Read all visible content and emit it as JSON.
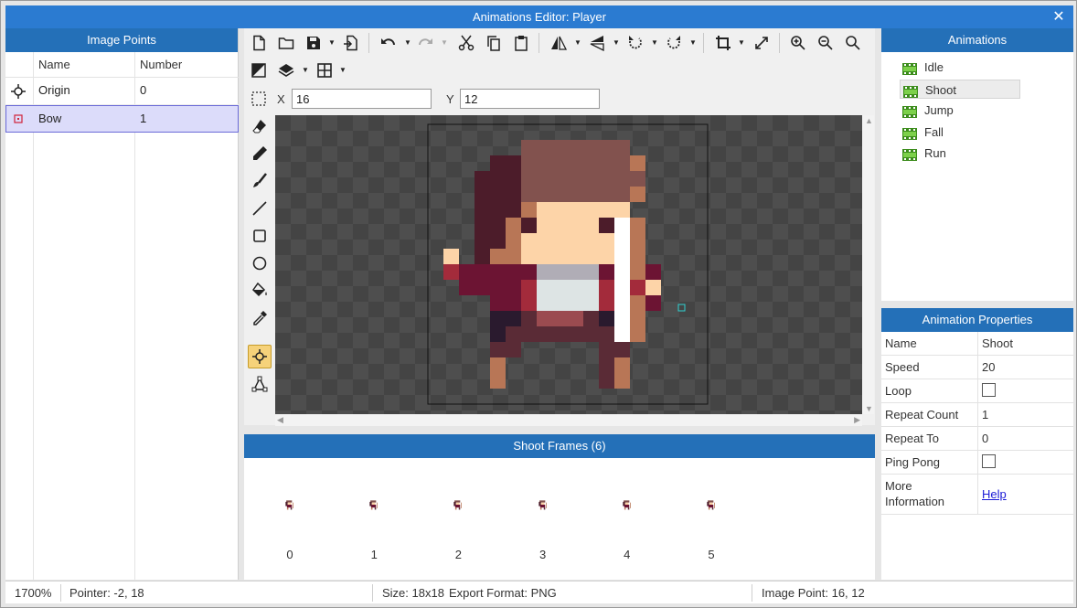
{
  "window": {
    "title": "Animations Editor: Player",
    "close_glyph": "✕"
  },
  "image_points": {
    "header": "Image Points",
    "columns": {
      "name": "Name",
      "number": "Number"
    },
    "rows": [
      {
        "icon": "crosshair-icon",
        "name": "Origin",
        "number": "0",
        "selected": false
      },
      {
        "icon": "point-marker-icon",
        "name": "Bow",
        "number": "1",
        "selected": true
      }
    ]
  },
  "toolbar": {
    "icons": [
      "new-file-icon",
      "open-folder-icon",
      "save-icon",
      "export-icon",
      "undo-icon",
      "redo-icon",
      "cut-icon",
      "copy-icon",
      "paste-icon",
      "flip-horizontal-icon",
      "flip-vertical-icon",
      "rotate-left-icon",
      "rotate-right-icon",
      "crop-icon",
      "resize-icon",
      "zoom-in-icon",
      "zoom-out-icon",
      "zoom-reset-icon",
      "invert-icon",
      "layers-icon",
      "grid-icon"
    ],
    "x_label": "X",
    "x_value": "16",
    "y_label": "Y",
    "y_value": "12"
  },
  "tools": [
    "eraser-icon",
    "pencil-icon",
    "brush-icon",
    "line-icon",
    "rectangle-icon",
    "ellipse-icon",
    "fill-bucket-icon",
    "eyedropper-icon",
    "image-point-tool-icon",
    "polygon-tool-icon"
  ],
  "active_tool": "image-point-tool-icon",
  "frames": {
    "header": "Shoot Frames (6)",
    "items": [
      "0",
      "1",
      "2",
      "3",
      "4",
      "5"
    ]
  },
  "animations": {
    "header": "Animations",
    "items": [
      {
        "label": "Idle",
        "selected": false
      },
      {
        "label": "Shoot",
        "selected": true
      },
      {
        "label": "Jump",
        "selected": false
      },
      {
        "label": "Fall",
        "selected": false
      },
      {
        "label": "Run",
        "selected": false
      }
    ]
  },
  "properties": {
    "header": "Animation Properties",
    "name_label": "Name",
    "name_value": "Shoot",
    "speed_label": "Speed",
    "speed_value": "20",
    "loop_label": "Loop",
    "loop_checked": false,
    "repeat_count_label": "Repeat Count",
    "repeat_count_value": "1",
    "repeat_to_label": "Repeat To",
    "repeat_to_value": "0",
    "ping_pong_label": "Ping Pong",
    "ping_pong_checked": false,
    "more_info_label_1": "More",
    "more_info_label_2": "Information",
    "help_link": "Help"
  },
  "status": {
    "zoom": "1700%",
    "pointer": "Pointer: -2, 18",
    "size": "Size: 18x18",
    "export_format": "Export Format: PNG",
    "image_point": "Image Point: 16, 12"
  },
  "colors": {
    "title_bar": "#2b7bd1",
    "panel_header": "#2470b8",
    "selection_row": "#dcdcfa",
    "active_tool": "#f6d27a",
    "sprite_hair": "#82524e",
    "sprite_skin": "#fdd4a8",
    "sprite_shirt": "#6c1433"
  }
}
